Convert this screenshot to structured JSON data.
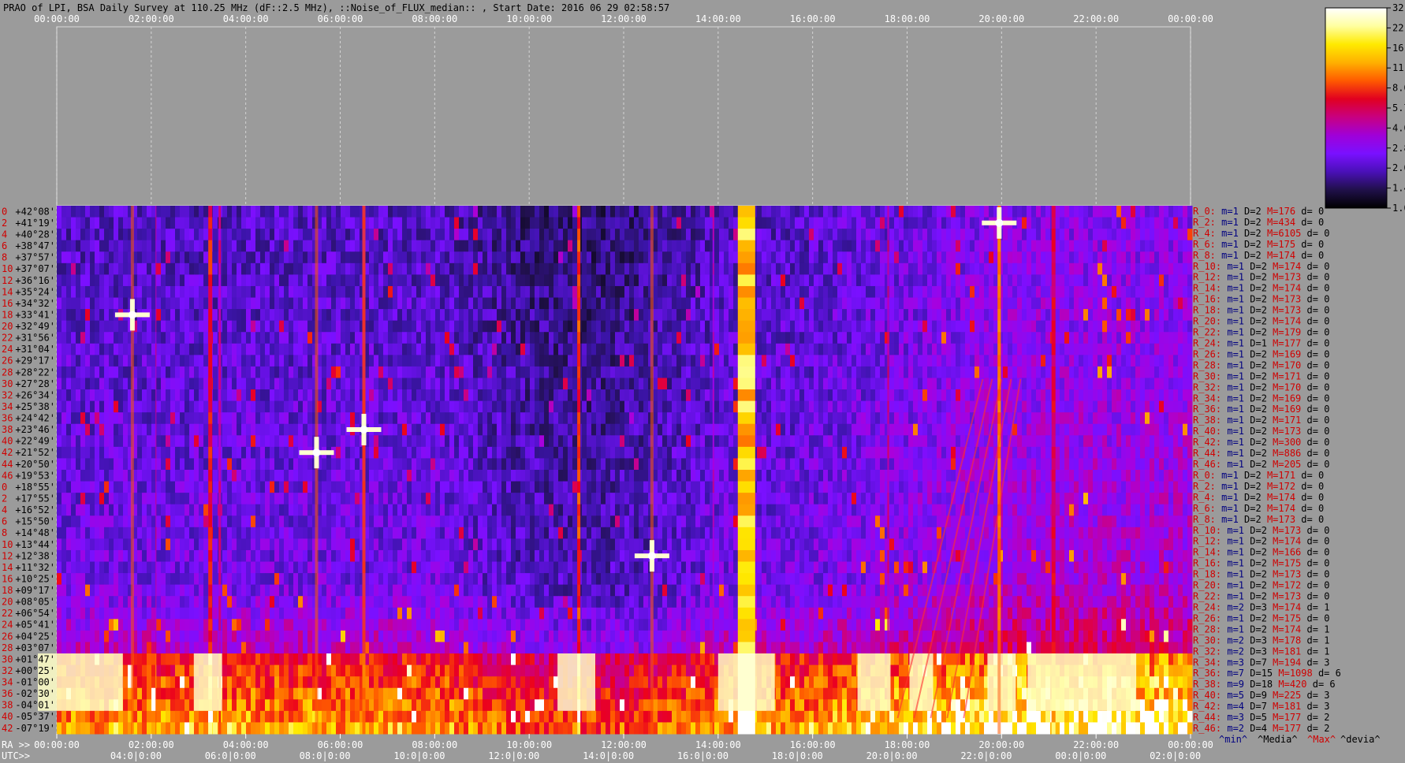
{
  "chart_data": {
    "type": "heatmap",
    "title": "PRAO of LPI, BSA Daily Survey at 110.25 MHz (dF::2.5 MHz), ::Noise_of_FLUX_median:: , Start Date: 2016 06 29 02:58:57",
    "top_time_ticks": [
      "00:00:00",
      "02:00:00",
      "04:00:00",
      "06:00:00",
      "08:00:00",
      "10:00:00",
      "12:00:00",
      "14:00:00",
      "16:00:00",
      "18:00:00",
      "20:00:00",
      "22:00:00",
      "00:00:00"
    ],
    "ra_axis_prefix": "RA >>",
    "ra_ticks": [
      "00:00:00",
      "02:00:00",
      "04:00:00",
      "06:00:00",
      "08:00:00",
      "10:00:00",
      "12:00:00",
      "14:00:00",
      "16:00:00",
      "18:00:00",
      "20:00:00",
      "22:00:00",
      "00:00:00"
    ],
    "utc_axis_prefix": "UTC>>",
    "utc_ticks": [
      "04:0|0:00",
      "06:0|0:00",
      "08:0|0:00",
      "10:0|0:00",
      "12:0|0:00",
      "14:0|0:00",
      "16:0|0:00",
      "18:0|0:00",
      "20:0|0:00",
      "22:0|0:00",
      "00:0|0:00",
      "02:0|0:00"
    ],
    "declinations": [
      "+42°08'",
      "+41°19'",
      "+40°28'",
      "+38°47'",
      "+37°57'",
      "+37°07'",
      "+36°16'",
      "+35°24'",
      "+34°32'",
      "+33°41'",
      "+32°49'",
      "+31°56'",
      "+31°04'",
      "+29°17'",
      "+28°22'",
      "+27°28'",
      "+26°34'",
      "+25°38'",
      "+24°42'",
      "+23°46'",
      "+22°49'",
      "+21°52'",
      "+20°50'",
      "+19°53'",
      "+18°55'",
      "+17°55'",
      "+16°52'",
      "+15°50'",
      "+14°48'",
      "+13°44'",
      "+12°38'",
      "+11°32'",
      "+10°25'",
      "+09°17'",
      "+08°05'",
      "+06°54'",
      "+05°41'",
      "+04°25'",
      "+03°07'",
      "+01°47'",
      "+00°25'",
      "-01°00'",
      "-02°30'",
      "-04°01'",
      "-05°37'",
      "-07°19'"
    ],
    "row_indices": [
      "0",
      "2",
      "4",
      "6",
      "8",
      "10",
      "12",
      "14",
      "16",
      "18",
      "20",
      "22",
      "24",
      "26",
      "28",
      "30",
      "32",
      "34",
      "36",
      "38",
      "40",
      "42",
      "44",
      "46",
      "0",
      "2",
      "4",
      "6",
      "8",
      "10",
      "12",
      "14",
      "16",
      "18",
      "20",
      "22",
      "24",
      "26",
      "28",
      "30",
      "32",
      "34",
      "36",
      "38",
      "40",
      "42",
      "44",
      "46"
    ],
    "row_stats": [
      {
        "r": "R_0:",
        "m": "m=1",
        "D": "D=2",
        "M": "M=176",
        "d": "d= 0"
      },
      {
        "r": "R_2:",
        "m": "m=1",
        "D": "D=2",
        "M": "M=434",
        "d": "d= 0"
      },
      {
        "r": "R_4:",
        "m": "m=1",
        "D": "D=2",
        "M": "M=6105",
        "d": "d= 0"
      },
      {
        "r": "R_6:",
        "m": "m=1",
        "D": "D=2",
        "M": "M=175",
        "d": "d= 0"
      },
      {
        "r": "R_8:",
        "m": "m=1",
        "D": "D=2",
        "M": "M=174",
        "d": "d= 0"
      },
      {
        "r": "R_10:",
        "m": "m=1",
        "D": "D=2",
        "M": "M=174",
        "d": "d= 0"
      },
      {
        "r": "R_12:",
        "m": "m=1",
        "D": "D=2",
        "M": "M=173",
        "d": "d= 0"
      },
      {
        "r": "R_14:",
        "m": "m=1",
        "D": "D=2",
        "M": "M=174",
        "d": "d= 0"
      },
      {
        "r": "R_16:",
        "m": "m=1",
        "D": "D=2",
        "M": "M=173",
        "d": "d= 0"
      },
      {
        "r": "R_18:",
        "m": "m=1",
        "D": "D=2",
        "M": "M=173",
        "d": "d= 0"
      },
      {
        "r": "R_20:",
        "m": "m=1",
        "D": "D=2",
        "M": "M=174",
        "d": "d= 0"
      },
      {
        "r": "R_22:",
        "m": "m=1",
        "D": "D=2",
        "M": "M=179",
        "d": "d= 0"
      },
      {
        "r": "R_24:",
        "m": "m=1",
        "D": "D=1",
        "M": "M=177",
        "d": "d= 0"
      },
      {
        "r": "R_26:",
        "m": "m=1",
        "D": "D=2",
        "M": "M=169",
        "d": "d= 0"
      },
      {
        "r": "R_28:",
        "m": "m=1",
        "D": "D=2",
        "M": "M=170",
        "d": "d= 0"
      },
      {
        "r": "R_30:",
        "m": "m=1",
        "D": "D=2",
        "M": "M=171",
        "d": "d= 0"
      },
      {
        "r": "R_32:",
        "m": "m=1",
        "D": "D=2",
        "M": "M=170",
        "d": "d= 0"
      },
      {
        "r": "R_34:",
        "m": "m=1",
        "D": "D=2",
        "M": "M=169",
        "d": "d= 0"
      },
      {
        "r": "R_36:",
        "m": "m=1",
        "D": "D=2",
        "M": "M=169",
        "d": "d= 0"
      },
      {
        "r": "R_38:",
        "m": "m=1",
        "D": "D=2",
        "M": "M=171",
        "d": "d= 0"
      },
      {
        "r": "R_40:",
        "m": "m=1",
        "D": "D=2",
        "M": "M=173",
        "d": "d= 0"
      },
      {
        "r": "R_42:",
        "m": "m=1",
        "D": "D=2",
        "M": "M=300",
        "d": "d= 0"
      },
      {
        "r": "R_44:",
        "m": "m=1",
        "D": "D=2",
        "M": "M=886",
        "d": "d= 0"
      },
      {
        "r": "R_46:",
        "m": "m=1",
        "D": "D=2",
        "M": "M=205",
        "d": "d= 0"
      },
      {
        "r": "R_0:",
        "m": "m=1",
        "D": "D=2",
        "M": "M=171",
        "d": "d= 0"
      },
      {
        "r": "R_2:",
        "m": "m=1",
        "D": "D=2",
        "M": "M=172",
        "d": "d= 0"
      },
      {
        "r": "R_4:",
        "m": "m=1",
        "D": "D=2",
        "M": "M=174",
        "d": "d= 0"
      },
      {
        "r": "R_6:",
        "m": "m=1",
        "D": "D=2",
        "M": "M=174",
        "d": "d= 0"
      },
      {
        "r": "R_8:",
        "m": "m=1",
        "D": "D=2",
        "M": "M=173",
        "d": "d= 0"
      },
      {
        "r": "R_10:",
        "m": "m=1",
        "D": "D=2",
        "M": "M=173",
        "d": "d= 0"
      },
      {
        "r": "R_12:",
        "m": "m=1",
        "D": "D=2",
        "M": "M=174",
        "d": "d= 0"
      },
      {
        "r": "R_14:",
        "m": "m=1",
        "D": "D=2",
        "M": "M=166",
        "d": "d= 0"
      },
      {
        "r": "R_16:",
        "m": "m=1",
        "D": "D=2",
        "M": "M=175",
        "d": "d= 0"
      },
      {
        "r": "R_18:",
        "m": "m=1",
        "D": "D=2",
        "M": "M=173",
        "d": "d= 0"
      },
      {
        "r": "R_20:",
        "m": "m=1",
        "D": "D=2",
        "M": "M=172",
        "d": "d= 0"
      },
      {
        "r": "R_22:",
        "m": "m=1",
        "D": "D=2",
        "M": "M=173",
        "d": "d= 0"
      },
      {
        "r": "R_24:",
        "m": "m=2",
        "D": "D=3",
        "M": "M=174",
        "d": "d= 1"
      },
      {
        "r": "R_26:",
        "m": "m=1",
        "D": "D=2",
        "M": "M=175",
        "d": "d= 0"
      },
      {
        "r": "R_28:",
        "m": "m=1",
        "D": "D=2",
        "M": "M=174",
        "d": "d= 1"
      },
      {
        "r": "R_30:",
        "m": "m=2",
        "D": "D=3",
        "M": "M=178",
        "d": "d= 1"
      },
      {
        "r": "R_32:",
        "m": "m=2",
        "D": "D=3",
        "M": "M=181",
        "d": "d= 1"
      },
      {
        "r": "R_34:",
        "m": "m=3",
        "D": "D=7",
        "M": "M=194",
        "d": "d= 3"
      },
      {
        "r": "R_36:",
        "m": "m=7",
        "D": "D=15",
        "M": "M=1098",
        "d": "d= 6"
      },
      {
        "r": "R_38:",
        "m": "m=9",
        "D": "D=18",
        "M": "M=420",
        "d": "d= 6"
      },
      {
        "r": "R_40:",
        "m": "m=5",
        "D": "D=9",
        "M": "M=225",
        "d": "d= 3"
      },
      {
        "r": "R_42:",
        "m": "m=4",
        "D": "D=7",
        "M": "M=181",
        "d": "d= 3"
      },
      {
        "r": "R_44:",
        "m": "m=3",
        "D": "D=5",
        "M": "M=177",
        "d": "d= 2"
      },
      {
        "r": "R_46:",
        "m": "m=2",
        "D": "D=4",
        "M": "M=177",
        "d": "d= 2"
      }
    ],
    "stats_legend": {
      "min": "^min^",
      "median": "^Media^",
      "max": "^Max^",
      "devia": "^devia^"
    },
    "colorbar_ticks": [
      "32.0",
      "22.6",
      "16.0",
      "11.3",
      "8.0",
      "5.7",
      "4.0",
      "2.8",
      "2.0",
      "1.4",
      "1.0"
    ],
    "colorbar_stops": [
      "#ffffff",
      "#ffffa0",
      "#ffea00",
      "#ffb000",
      "#ff5a00",
      "#e10020",
      "#c80080",
      "#a000d8",
      "#7a10ff",
      "#4a10b8",
      "#20104a",
      "#000000"
    ],
    "vertical_streaks": [
      {
        "ra_hour": 2.1,
        "level": 0.55,
        "width": 1
      },
      {
        "ra_hour": 3.25,
        "level": 0.7,
        "width": 5
      },
      {
        "ra_hour": 3.45,
        "level": 0.55,
        "width": 3
      },
      {
        "ra_hour": 6.5,
        "level": 0.6,
        "width": 4
      },
      {
        "ra_hour": 11.05,
        "level": 0.75,
        "width": 4
      },
      {
        "ra_hour": 13.9,
        "level": 0.5,
        "width": 2
      },
      {
        "ra_hour": 14.6,
        "level": 0.9,
        "width": 22
      },
      {
        "ra_hour": 17.6,
        "level": 0.55,
        "width": 2
      },
      {
        "ra_hour": 19.95,
        "level": 0.85,
        "width": 4
      },
      {
        "ra_hour": 21.1,
        "level": 0.65,
        "width": 5
      }
    ],
    "point_sources": [
      {
        "ra_hour": 5.5,
        "dec": "+21°52'",
        "level": 0.9
      },
      {
        "ra_hour": 6.5,
        "dec": "+23°46'",
        "level": 1.0
      },
      {
        "ra_hour": 19.95,
        "dec": "+41°19'",
        "level": 1.0
      },
      {
        "ra_hour": 12.6,
        "dec": "+12°38'",
        "level": 0.95
      },
      {
        "ra_hour": 1.6,
        "dec": "+33°41'",
        "level": 0.9
      }
    ]
  }
}
